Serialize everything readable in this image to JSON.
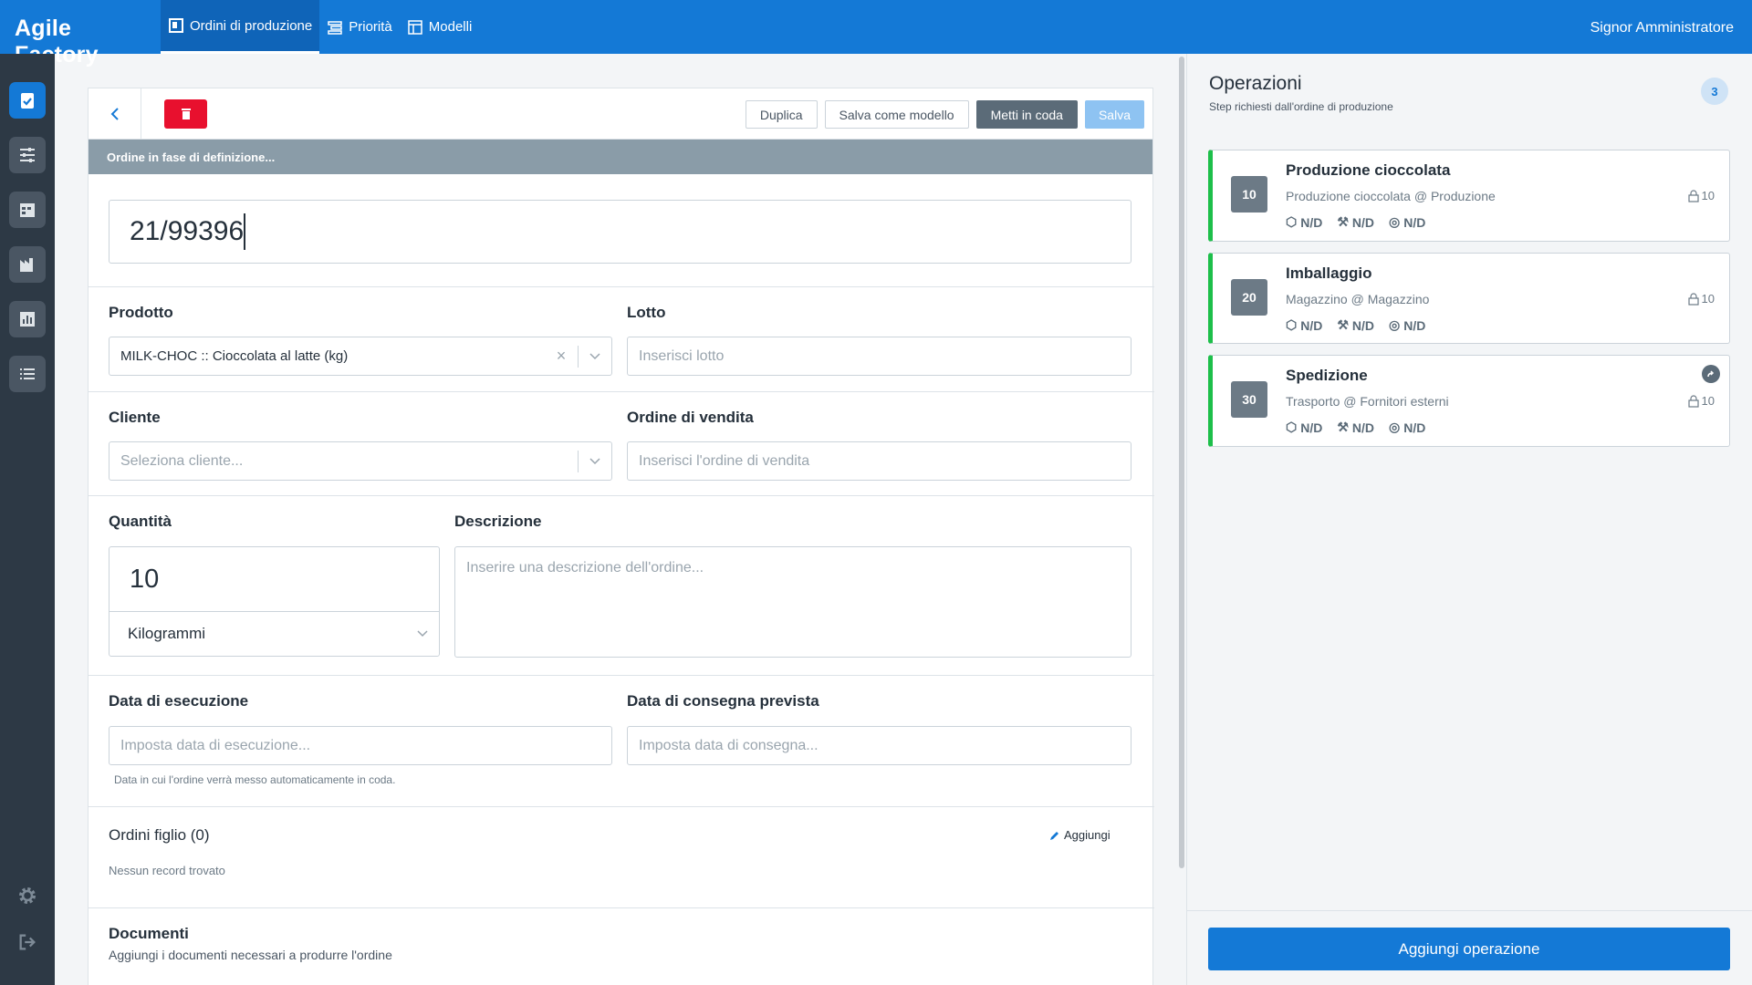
{
  "app": {
    "title": "Agile Factory",
    "user": "Signor Amministratore"
  },
  "nav": [
    {
      "label": "Ordini di produzione",
      "icon": "orders-icon"
    },
    {
      "label": "Priorità",
      "icon": "priority-icon"
    },
    {
      "label": "Modelli",
      "icon": "models-icon"
    }
  ],
  "sidebar": {
    "items": [
      "orders",
      "planning",
      "calendar",
      "production",
      "reports",
      "list"
    ],
    "bottom": [
      "settings",
      "logout"
    ]
  },
  "toolbar": {
    "duplicate": "Duplica",
    "save_template": "Salva come modello",
    "queue": "Metti in coda",
    "save": "Salva"
  },
  "status": "Ordine in fase di definizione...",
  "order": {
    "code": "21/99396"
  },
  "form": {
    "product_label": "Prodotto",
    "product_value": "MILK-CHOC :: Cioccolata al latte (kg)",
    "lot_label": "Lotto",
    "lot_placeholder": "Inserisci lotto",
    "customer_label": "Cliente",
    "customer_placeholder": "Seleziona cliente...",
    "sales_order_label": "Ordine di vendita",
    "sales_order_placeholder": "Inserisci l'ordine di vendita",
    "quantity_label": "Quantità",
    "quantity_value": "10",
    "unit_value": "Kilogrammi",
    "description_label": "Descrizione",
    "description_placeholder": "Inserire una descrizione dell'ordine...",
    "exec_date_label": "Data di esecuzione",
    "exec_date_placeholder": "Imposta data di esecuzione...",
    "exec_date_help": "Data in cui l'ordine verrà messo automaticamente in coda.",
    "delivery_date_label": "Data di consegna prevista",
    "delivery_date_placeholder": "Imposta data di consegna...",
    "children_label": "Ordini figlio (0)",
    "children_add": "Aggiungi",
    "children_empty": "Nessun record trovato",
    "documents_label": "Documenti",
    "documents_sub": "Aggiungi i documenti necessari a produrre l'ordine"
  },
  "operations": {
    "title": "Operazioni",
    "subtitle": "Step richiesti dall'ordine di produzione",
    "count": "3",
    "add_button": "Aggiungi operazione",
    "items": [
      {
        "num": "10",
        "name": "Produzione cioccolata",
        "location": "Produzione cioccolata @ Produzione",
        "qty": "10",
        "m1": "N/D",
        "m2": "N/D",
        "m3": "N/D"
      },
      {
        "num": "20",
        "name": "Imballaggio",
        "location": "Magazzino @ Magazzino",
        "qty": "10",
        "m1": "N/D",
        "m2": "N/D",
        "m3": "N/D"
      },
      {
        "num": "30",
        "name": "Spedizione",
        "location": "Trasporto @ Fornitori esterni",
        "qty": "10",
        "m1": "N/D",
        "m2": "N/D",
        "m3": "N/D"
      }
    ]
  },
  "colors": {
    "primary": "#1479d6",
    "danger": "#e8102e",
    "success": "#1dbf4a",
    "sidebar": "#2d3945"
  }
}
